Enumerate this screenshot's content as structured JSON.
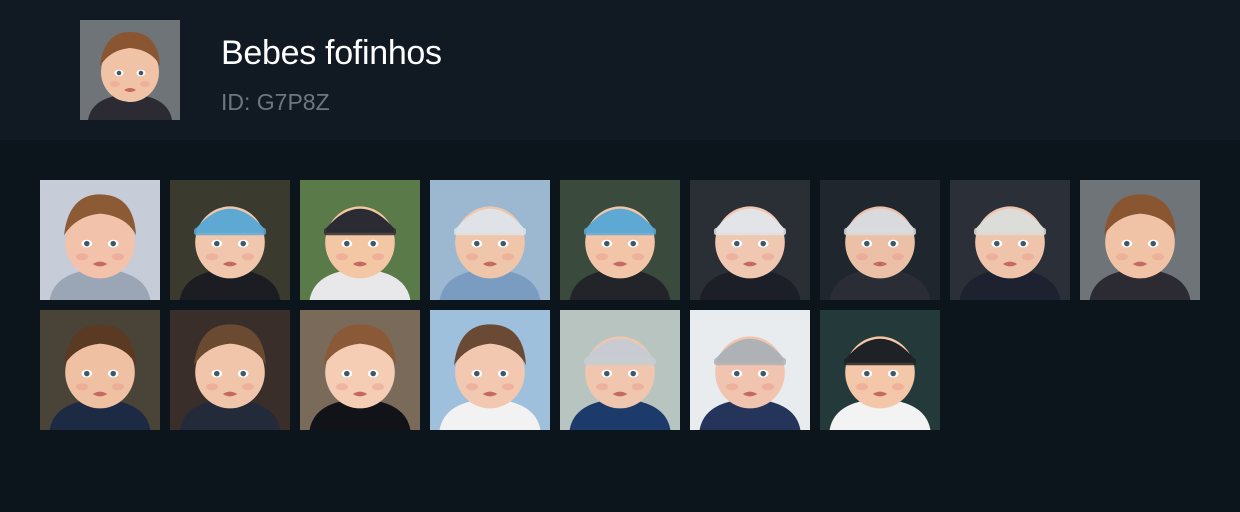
{
  "pack": {
    "title": "Bebes fofinhos",
    "id_text": "ID: G7P8Z"
  },
  "avatar_image": {
    "skin": "#f1c3a6",
    "hair": "#8a5632",
    "bg": "#6f7478",
    "clothes": "#2c2a33",
    "hat": "none"
  },
  "stickers": [
    {
      "skin": "#f2c2ab",
      "hair": "#8d5a36",
      "bg": "#c6cdd8",
      "clothes": "#9aa5b5",
      "hat": "none"
    },
    {
      "skin": "#f0c7ad",
      "hair": "#6b4a32",
      "bg": "#3a3a2e",
      "clothes": "#1c1d22",
      "hat": "#5ea8d4"
    },
    {
      "skin": "#f4c7a4",
      "hair": "#6a4a2c",
      "bg": "#5a7a4a",
      "clothes": "#e8e8ea",
      "hat": "#2a2b33"
    },
    {
      "skin": "#f0c6ab",
      "hair": "#7a5a3c",
      "bg": "#9bb8d0",
      "clothes": "#7a9cc0",
      "hat": "#dfe3e8"
    },
    {
      "skin": "#f2c5a8",
      "hair": "#7a5a3c",
      "bg": "#3a4a3c",
      "clothes": "#22242a",
      "hat": "#5ea8d4"
    },
    {
      "skin": "#f0c7b1",
      "hair": "#7a5a3c",
      "bg": "#2a2f36",
      "clothes": "#1c1f28",
      "hat": "#e2e4e8"
    },
    {
      "skin": "#ecc0a6",
      "hair": "#7a5a3c",
      "bg": "#1f262e",
      "clothes": "#2a2d36",
      "hat": "#d9dadd"
    },
    {
      "skin": "#f0c4aa",
      "hair": "#7a5a3c",
      "bg": "#2b3038",
      "clothes": "#1e2230",
      "hat": "#dcdcd8"
    },
    {
      "skin": "#f1c3a6",
      "hair": "#8a5632",
      "bg": "#6f7478",
      "clothes": "#2c2a33",
      "hat": "none"
    },
    {
      "skin": "#f0c0a2",
      "hair": "#5a3a22",
      "bg": "#4a4438",
      "clothes": "#1d2a44",
      "hat": "none"
    },
    {
      "skin": "#f1c5aa",
      "hair": "#6a4a30",
      "bg": "#3a2e2a",
      "clothes": "#232a3a",
      "hat": "none"
    },
    {
      "skin": "#f4cdb4",
      "hair": "#8a5a38",
      "bg": "#7a6a5a",
      "clothes": "#111318",
      "hat": "none"
    },
    {
      "skin": "#f2c8b0",
      "hair": "#6a4a34",
      "bg": "#9ec0dc",
      "clothes": "#f2f2f2",
      "hat": "none"
    },
    {
      "skin": "#f0c6ae",
      "hair": "#7a5a3c",
      "bg": "#b8c4c0",
      "clothes": "#1c3a6a",
      "hat": "#c8ccd2"
    },
    {
      "skin": "#f0c4ae",
      "hair": "#7a5a3c",
      "bg": "#e8ecef",
      "clothes": "#24345a",
      "hat": "#aeb2b6"
    },
    {
      "skin": "#f3c7a8",
      "hair": "#7a5a3c",
      "bg": "#243a3a",
      "clothes": "#f3f3f3",
      "hat": "#1e2226"
    }
  ]
}
